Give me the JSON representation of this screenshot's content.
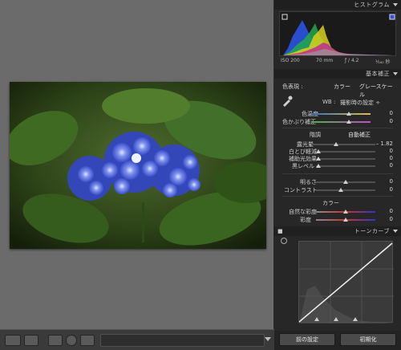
{
  "panel": {
    "histogram_title": "ヒストグラム",
    "hist_info": {
      "iso": "ISO 200",
      "focal": "70 mm",
      "aperture": "ƒ / 4.2",
      "shutter": "¹⁄₁₆₀ 秒"
    },
    "basic_title": "基本補正",
    "treatment_label": "色表現 :",
    "treatment_color": "カラー",
    "treatment_gray": "グレースケール",
    "wb_label": "WB :",
    "wb_value": "撮影時の設定 ÷",
    "temp_label": "色温度",
    "temp_value": "0",
    "tint_label": "色かぶり補正",
    "tint_value": "0",
    "tone_label": "階調",
    "auto_label": "自動補正",
    "exposure_label": "露光量",
    "exposure_value": "– 1.82",
    "highlight_label": "白とび軽減",
    "highlight_value": "0",
    "fill_label": "補助光効果",
    "fill_value": "0",
    "black_label": "黒レベル",
    "black_value": "0",
    "bright_label": "明るさ",
    "bright_value": "0",
    "contrast_label": "コントラスト",
    "contrast_value": "0",
    "presence_label": "カラー",
    "vibrance_label": "自然な彩度",
    "vibrance_value": "0",
    "saturation_label": "彩度",
    "saturation_value": "0",
    "tonecurve_title": "トーンカーブ",
    "prev_button": "前の設定",
    "reset_button": "初期化"
  },
  "colors": {
    "panel_bg": "#272727",
    "canvas_bg": "#6b6b6b"
  }
}
